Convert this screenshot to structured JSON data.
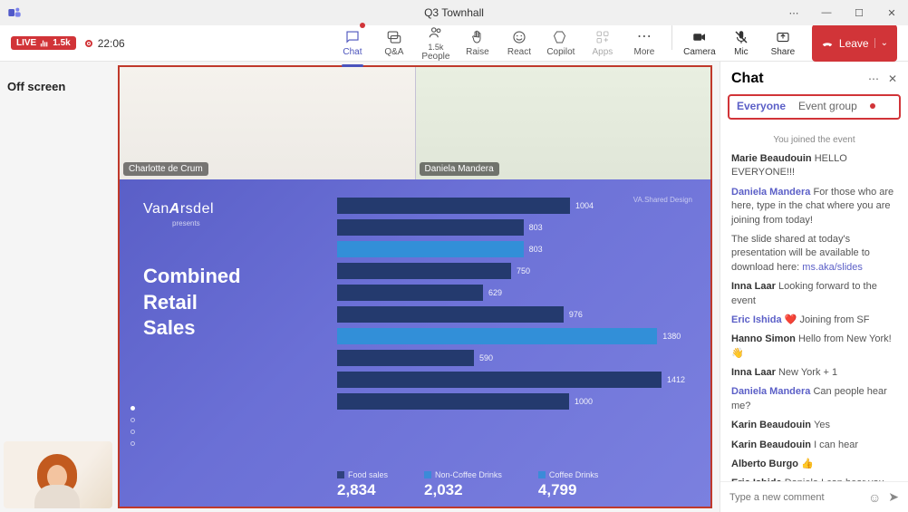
{
  "window": {
    "title": "Q3 Townhall"
  },
  "toolbar": {
    "live_label": "LIVE",
    "viewer_count": "1.5k",
    "rec_time": "22:06",
    "buttons": {
      "chat": "Chat",
      "qa": "Q&A",
      "people": "People",
      "people_count": "1.5k",
      "raise": "Raise",
      "react": "React",
      "copilot": "Copilot",
      "apps": "Apps",
      "more": "More",
      "camera": "Camera",
      "mic": "Mic",
      "share": "Share",
      "leave": "Leave"
    }
  },
  "left_panel": {
    "off_screen": "Off screen"
  },
  "participants": [
    {
      "name": "Charlotte de Crum"
    },
    {
      "name": "Daniela Mandera"
    }
  ],
  "slide": {
    "brand_prefix": "Van",
    "brand_suffix": "rsdel",
    "presents": "presents",
    "attribution": "VA.Shared Design",
    "heading_line1": "Combined",
    "heading_line2": "Retail",
    "heading_line3": "Sales",
    "legend": [
      {
        "label": "Food sales",
        "value": "2,834"
      },
      {
        "label": "Non-Coffee Drinks",
        "value": "2,032"
      },
      {
        "label": "Coffee Drinks",
        "value": "4,799"
      }
    ]
  },
  "chart_data": {
    "type": "bar",
    "orientation": "horizontal",
    "series": [
      {
        "name": "dark",
        "color": "#243a6e",
        "values": [
          1004,
          803,
          750,
          629,
          976,
          590,
          1412,
          1000
        ]
      },
      {
        "name": "light",
        "color": "#328fd8",
        "values": [
          null,
          803,
          null,
          null,
          1380,
          null,
          null,
          null
        ]
      }
    ],
    "legend": [
      {
        "label": "Food sales",
        "value": 2834
      },
      {
        "label": "Non-Coffee Drinks",
        "value": 2032
      },
      {
        "label": "Coffee Drinks",
        "value": 4799
      }
    ],
    "max_scale": 1500
  },
  "chat": {
    "title": "Chat",
    "tabs": {
      "everyone": "Everyone",
      "event_group": "Event group"
    },
    "system_msg": "You joined the event",
    "messages": [
      {
        "author": "Marie Beaudouin",
        "text": "HELLO EVERYONE!!!",
        "author_link": false
      },
      {
        "author": "Daniela Mandera",
        "text": "For those who are here, type in the chat where you are joining from today!",
        "author_link": true
      },
      {
        "author": "",
        "text": "The slide shared at today's presentation will be available to download here: ",
        "link": "ms.aka/slides",
        "author_link": false,
        "continuation": true
      },
      {
        "author": "Inna Laar",
        "text": "Looking forward to the event",
        "author_link": false
      },
      {
        "author": "Eric Ishida",
        "text": "❤️ Joining from SF",
        "author_link": true
      },
      {
        "author": "Hanno Simon",
        "text": "Hello from New York!  👋",
        "author_link": false
      },
      {
        "author": "Inna Laar",
        "text": "New York + 1",
        "author_link": false
      },
      {
        "author": "Daniela Mandera",
        "text": "Can people hear me?",
        "author_link": true
      },
      {
        "author": "Karin Beaudouin",
        "text": "Yes",
        "author_link": false
      },
      {
        "author": "Karin Beaudouin",
        "text": "I can hear",
        "author_link": false
      },
      {
        "author": "Alberto Burgo",
        "text": "👍",
        "author_link": false
      },
      {
        "author": "Eric Ishida",
        "text": "Daniela I can hear you",
        "author_link": false
      }
    ],
    "input_placeholder": "Type a new comment"
  }
}
